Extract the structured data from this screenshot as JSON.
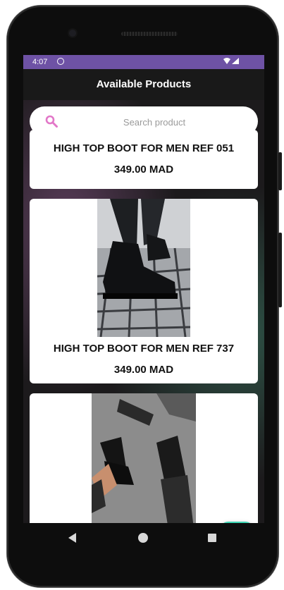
{
  "status_bar": {
    "time": "4:07",
    "sync_icon": "sync-icon",
    "wifi_icon": "wifi-icon",
    "signal_icon": "signal-icon"
  },
  "app_bar": {
    "title": "Available Products"
  },
  "search": {
    "placeholder": "Search product",
    "icon": "search-icon",
    "icon_color": "#e277c8"
  },
  "products": [
    {
      "name": "HIGH TOP BOOT FOR MEN REF 051",
      "price": "349.00 MAD"
    },
    {
      "name": "HIGH TOP BOOT FOR MEN REF 737",
      "price": "349.00 MAD"
    },
    {
      "name": "",
      "price": ""
    }
  ],
  "fab": {
    "icon": "add-to-cart-icon",
    "color": "#3ed7b5"
  },
  "nav": {
    "back_icon": "back-icon",
    "home_icon": "home-icon",
    "recents_icon": "recents-icon"
  },
  "colors": {
    "status_bar": "#6e52a5",
    "app_bar": "#191919",
    "accent": "#3ed7b5"
  }
}
